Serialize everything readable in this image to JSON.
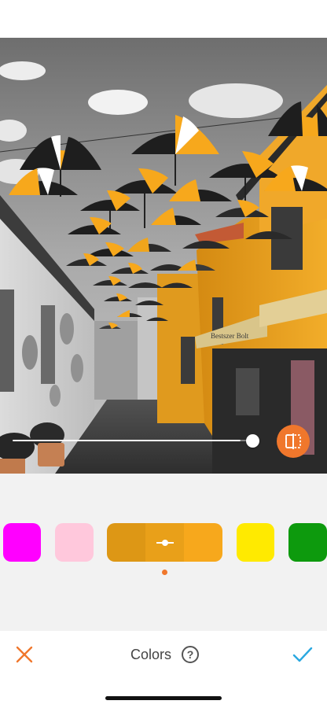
{
  "toolbar": {
    "title": "Colors",
    "help_label": "?",
    "cancel_icon": "close-icon",
    "confirm_icon": "checkmark-icon"
  },
  "slider": {
    "value": 0.94
  },
  "swatches": [
    {
      "name": "magenta",
      "color": "#ff00ff"
    },
    {
      "name": "pink",
      "color": "#ffc8dc"
    },
    {
      "name": "orange",
      "color": "#f7a81c",
      "selected": true
    },
    {
      "name": "yellow",
      "color": "#ffea00"
    },
    {
      "name": "green",
      "color": "#0d9a0d"
    }
  ],
  "colors": {
    "accent": "#f0772c",
    "check": "#2aa8e0"
  },
  "photo": {
    "shop_sign": "Bestszer Bolt"
  }
}
